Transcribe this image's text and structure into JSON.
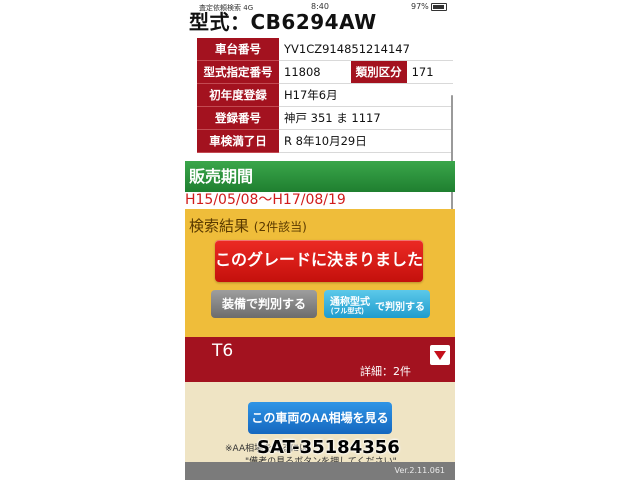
{
  "status_bar": {
    "carrier": "査定依頼検索",
    "network": "4G",
    "time": "8:40",
    "battery": "97%"
  },
  "header": {
    "title": "型式：CB6294AW"
  },
  "vehicle_info": {
    "chassis_label": "車台番号",
    "chassis_value": "YV1CZ914851214147",
    "model_designation_label": "型式指定番号",
    "model_designation_value": "11808",
    "category_label": "類別区分",
    "category_value": "171",
    "first_registration_label": "初年度登録",
    "first_registration_value": "H17年6月",
    "registration_number_label": "登録番号",
    "registration_number_value": "神戸 351 ま 1117",
    "inspection_expiry_label": "車検満了日",
    "inspection_expiry_value": "R 8年10月29日"
  },
  "sales_period": {
    "label": "販売期間",
    "value": "H15/05/08〜H17/08/19"
  },
  "search_results": {
    "title": "検索結果",
    "count": "(2件該当)",
    "decide_grade_label": "このグレードに決まりました",
    "equipment_button_label": "装備で判別する",
    "common_model_line1": "通称型式",
    "common_model_line2": "(フル型式)",
    "common_model_line3": "で判別する"
  },
  "grade": {
    "name": "T6",
    "detail": "詳細：2件"
  },
  "aa_price": {
    "button_label": "この車両のAA相場を見る",
    "note_line1": "※AA相場を見るには",
    "note_line2": "\"備考の見るボタンを押してください\""
  },
  "overlay": {
    "id_text": "SAT-35184356"
  },
  "footer": {
    "version": "Ver.2.11.061"
  },
  "colors": {
    "dark_red": "#a3121f",
    "green": "#2e9a3f",
    "yellow": "#efbd3a",
    "red_button": "#e0201a",
    "blue_button": "#1f78d1",
    "cream": "#efe4c4"
  }
}
